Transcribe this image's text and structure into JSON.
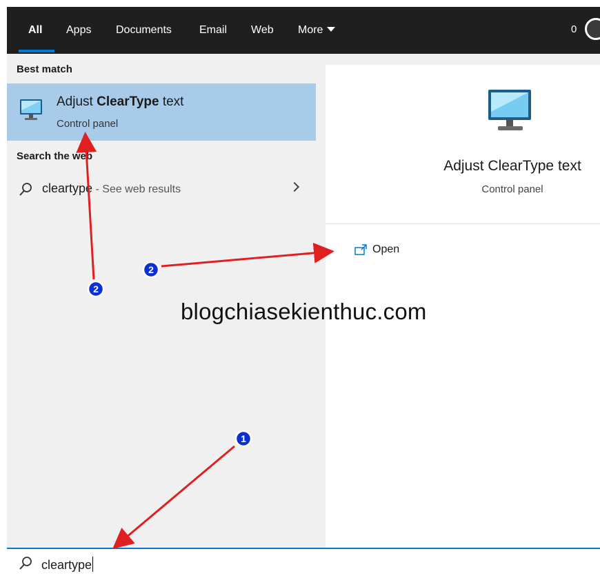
{
  "nav": {
    "tabs": [
      {
        "label": "All",
        "active": true
      },
      {
        "label": "Apps"
      },
      {
        "label": "Documents"
      },
      {
        "label": "Email"
      },
      {
        "label": "Web"
      },
      {
        "label": "More"
      }
    ],
    "points": "0"
  },
  "best_match": {
    "section_label": "Best match",
    "title_prefix": "Adjust ",
    "title_bold": "ClearType",
    "title_suffix": " text",
    "subtitle": "Control panel",
    "icon": "monitor-icon"
  },
  "web": {
    "section_label": "Search the web",
    "query": "cleartype",
    "suffix": " - See web results",
    "icon": "search-icon"
  },
  "preview": {
    "title": "Adjust ClearType text",
    "subtitle": "Control panel",
    "icon": "monitor-icon",
    "actions": [
      {
        "label": "Open",
        "icon": "open-icon"
      }
    ]
  },
  "search": {
    "value": "cleartype",
    "icon": "search-icon"
  },
  "watermark": "blogchiasekienthuc.com",
  "annotations": {
    "badges": [
      "1",
      "2",
      "2"
    ],
    "color": "#e02020",
    "badge_color": "#0a2fd6"
  }
}
